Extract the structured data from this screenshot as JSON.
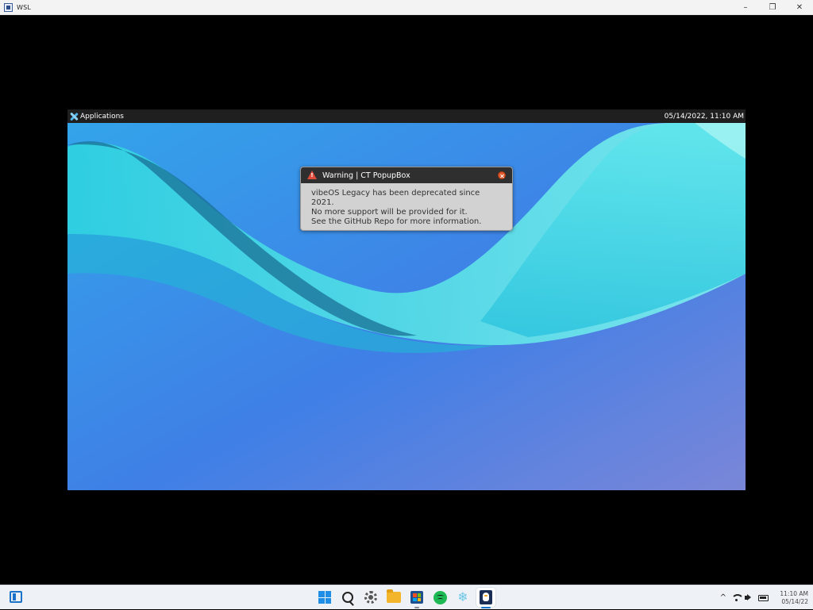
{
  "window": {
    "title": "WSL",
    "controls": {
      "minimize": "–",
      "restore": "❐",
      "close": "✕"
    }
  },
  "guest": {
    "topbar": {
      "applications_label": "Applications",
      "datetime": "05/14/2022, 11:10 AM"
    },
    "popup": {
      "title": "Warning | CT PopupBox",
      "lines": [
        "vibeOS Legacy has been deprecated since 2021.",
        "No more support will be provided for it.",
        "See the GitHub Repo for more information."
      ]
    }
  },
  "taskbar": {
    "icons": [
      "widgets-icon",
      "start-icon",
      "search-icon",
      "settings-icon",
      "file-explorer-icon",
      "microsoft-store-icon",
      "spotify-icon",
      "snowflake-app-icon",
      "wsl-tux-icon"
    ],
    "tray": {
      "chevron": "^",
      "time": "11:10 AM",
      "date": "05/14/22"
    }
  },
  "colors": {
    "accent": "#1a73c8",
    "popup_title_bg": "#2f2f2f",
    "warning_red": "#e04a3a"
  }
}
